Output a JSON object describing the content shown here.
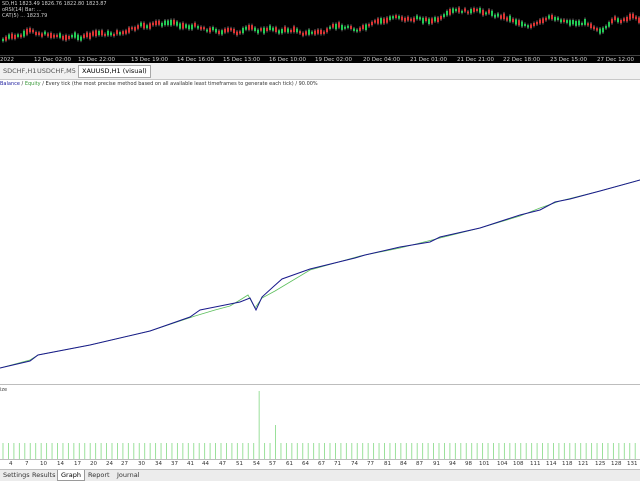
{
  "top_chart": {
    "ohlc_lines": [
      "SD,H1  1823.49 1826.76 1822.80 1823.87",
      "oRSI(14) Bar: ...",
      "CAT(5) ... 1823.79"
    ],
    "time_labels": [
      "2022",
      "12 Dec 02:00",
      "12 Dec 22:00",
      "13 Dec 19:00",
      "14 Dec 16:00",
      "15 Dec 13:00",
      "16 Dec 10:00",
      "19 Dec 02:00",
      "20 Dec 04:00",
      "21 Dec 01:00",
      "21 Dec 21:00",
      "22 Dec 18:00",
      "23 Dec 15:00",
      "27 Dec 12:00"
    ]
  },
  "symbol_tabs": [
    {
      "label": "SDCHF,H1",
      "active": false
    },
    {
      "label": "USDCHF,M5",
      "active": false
    },
    {
      "label": "XAUUSD,H1 (visual)",
      "active": true
    }
  ],
  "legend": {
    "balance": "Balance",
    "sep1": " / ",
    "equity": "Equity",
    "description": " / Every tick (the most precise method based on all available least timeframes to generate each tick) / 90.00%"
  },
  "colors": {
    "balance": "#1a1a8c",
    "equity": "#5cbf5c",
    "deposit_bars": "#90dd90",
    "chart_bg": "#000000"
  },
  "lower_panel": {
    "label": "ize"
  },
  "x_ticks": [
    "4",
    "7",
    "10",
    "14",
    "17",
    "20",
    "24",
    "27",
    "30",
    "34",
    "37",
    "41",
    "44",
    "47",
    "51",
    "54",
    "57",
    "61",
    "64",
    "67",
    "71",
    "74",
    "77",
    "81",
    "84",
    "87",
    "91",
    "94",
    "98",
    "101",
    "104",
    "108",
    "111",
    "114",
    "118",
    "121",
    "125",
    "128",
    "131"
  ],
  "bottom_tabs": [
    {
      "label": "Settings",
      "active": false
    },
    {
      "label": "Results",
      "active": false
    },
    {
      "label": "Graph",
      "active": true
    },
    {
      "label": "Report",
      "active": false
    },
    {
      "label": "Journal",
      "active": false
    }
  ]
}
